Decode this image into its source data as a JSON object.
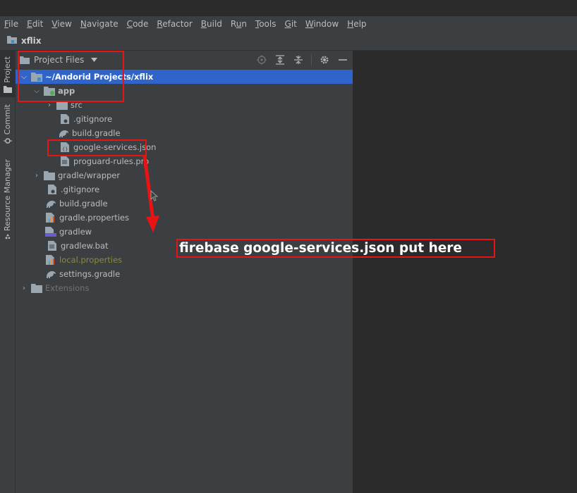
{
  "menu": [
    "File",
    "Edit",
    "View",
    "Navigate",
    "Code",
    "Refactor",
    "Build",
    "Run",
    "Tools",
    "Git",
    "Window",
    "Help"
  ],
  "menu_underline": [
    "F",
    "E",
    "V",
    "N",
    "C",
    "R",
    "B",
    "u",
    "T",
    "G",
    "W",
    "H"
  ],
  "breadcrumb": {
    "project": "xflix"
  },
  "side_tabs": {
    "project": "Project",
    "commit": "Commit",
    "resource_manager": "Resource Manager"
  },
  "panel": {
    "title": "Project Files"
  },
  "tree": [
    {
      "label": "~/Andorid Projects/xflix",
      "type": "folder-module",
      "expanded": true,
      "selected": true
    },
    {
      "label": "app",
      "type": "folder-module-green",
      "expanded": true
    },
    {
      "label": "src",
      "type": "folder",
      "expanded": false
    },
    {
      "label": ".gitignore",
      "type": "file-gitignore"
    },
    {
      "label": "build.gradle",
      "type": "file-gradle"
    },
    {
      "label": "google-services.json",
      "type": "file-json"
    },
    {
      "label": "proguard-rules.pro",
      "type": "file-text"
    },
    {
      "label": "gradle/wrapper",
      "type": "folder",
      "expanded": false
    },
    {
      "label": ".gitignore",
      "type": "file-gitignore"
    },
    {
      "label": "build.gradle",
      "type": "file-gradle"
    },
    {
      "label": "gradle.properties",
      "type": "file-properties"
    },
    {
      "label": "gradlew",
      "type": "file-script"
    },
    {
      "label": "gradlew.bat",
      "type": "file-text"
    },
    {
      "label": "local.properties",
      "type": "file-properties-local"
    },
    {
      "label": "settings.gradle",
      "type": "file-gradle"
    },
    {
      "label": "Extensions",
      "type": "folder-grey",
      "expanded": false
    }
  ],
  "annotation": {
    "callout_text": "firebase google-services.json put here",
    "color": "#e81313"
  },
  "colors": {
    "selection": "#2f65ca",
    "panel": "#3c3f41",
    "editor": "#2b2b2b"
  }
}
